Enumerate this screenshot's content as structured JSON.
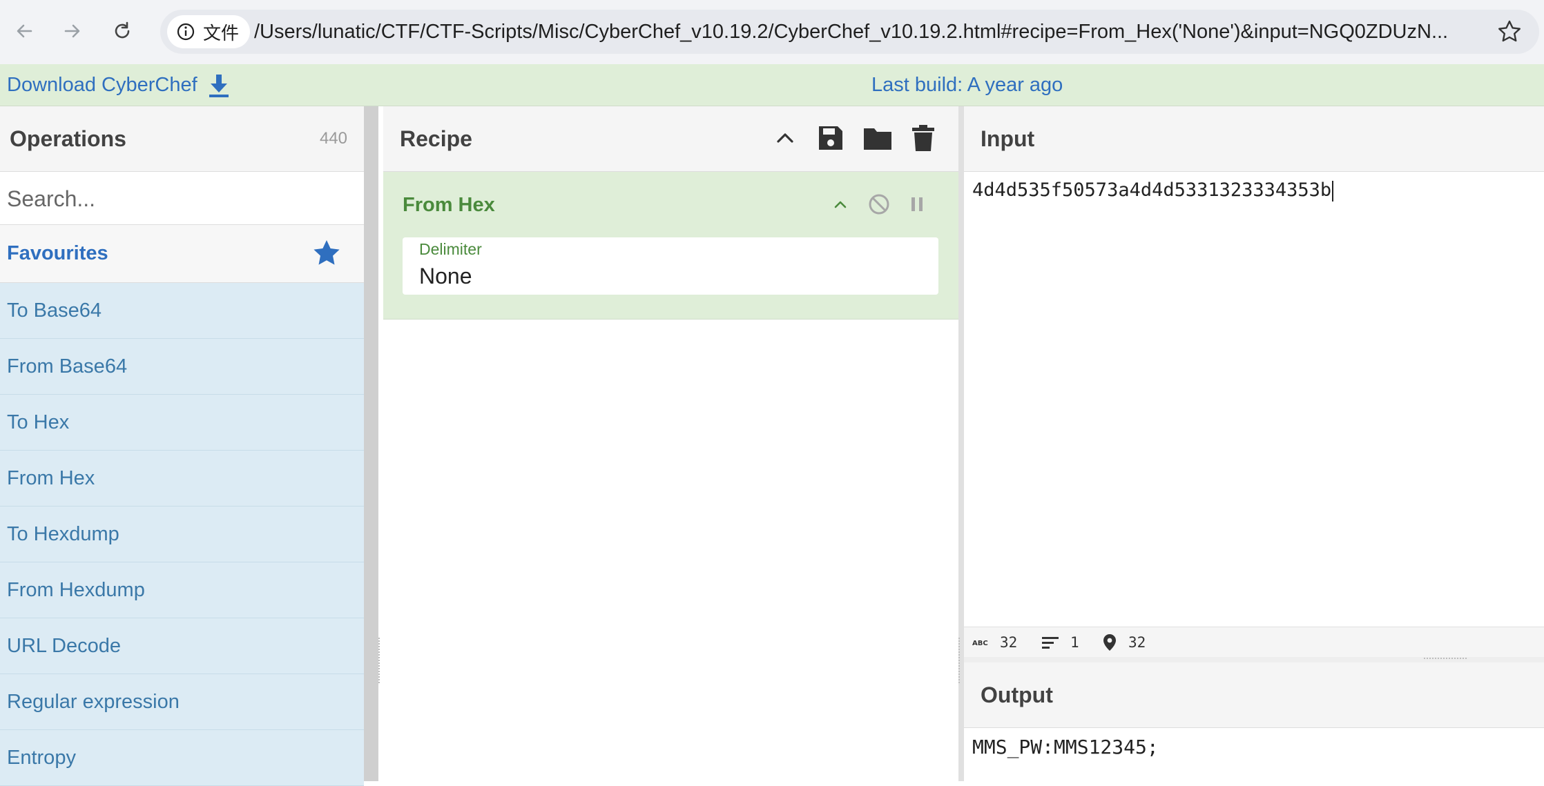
{
  "browser": {
    "site_chip": "文件",
    "url": "/Users/lunatic/CTF/CTF-Scripts/Misc/CyberChef_v10.19.2/CyberChef_v10.19.2.html#recipe=From_Hex('None')&input=NGQ0ZDUzN..."
  },
  "banner": {
    "download_label": "Download CyberChef",
    "build_label": "Last build: A year ago"
  },
  "operations": {
    "title": "Operations",
    "count": "440",
    "search_placeholder": "Search...",
    "favourites_label": "Favourites",
    "items": [
      {
        "label": "To Base64"
      },
      {
        "label": "From Base64"
      },
      {
        "label": "To Hex"
      },
      {
        "label": "From Hex"
      },
      {
        "label": "To Hexdump"
      },
      {
        "label": "From Hexdump"
      },
      {
        "label": "URL Decode"
      },
      {
        "label": "Regular expression"
      },
      {
        "label": "Entropy"
      }
    ]
  },
  "recipe": {
    "title": "Recipe",
    "operation_name": "From Hex",
    "delimiter_label": "Delimiter",
    "delimiter_value": "None"
  },
  "input": {
    "title": "Input",
    "text": "4d4d535f50573a4d4d5331323334353b",
    "stats": {
      "chars": "32",
      "lines": "1",
      "position": "32"
    }
  },
  "output": {
    "title": "Output",
    "text": "MMS_PW:MMS12345;"
  },
  "colors": {
    "banner_bg": "#dfeed8",
    "link_blue": "#2f6fbf",
    "op_item_bg": "#dcebf4",
    "recipe_green": "#4a8a3c"
  }
}
